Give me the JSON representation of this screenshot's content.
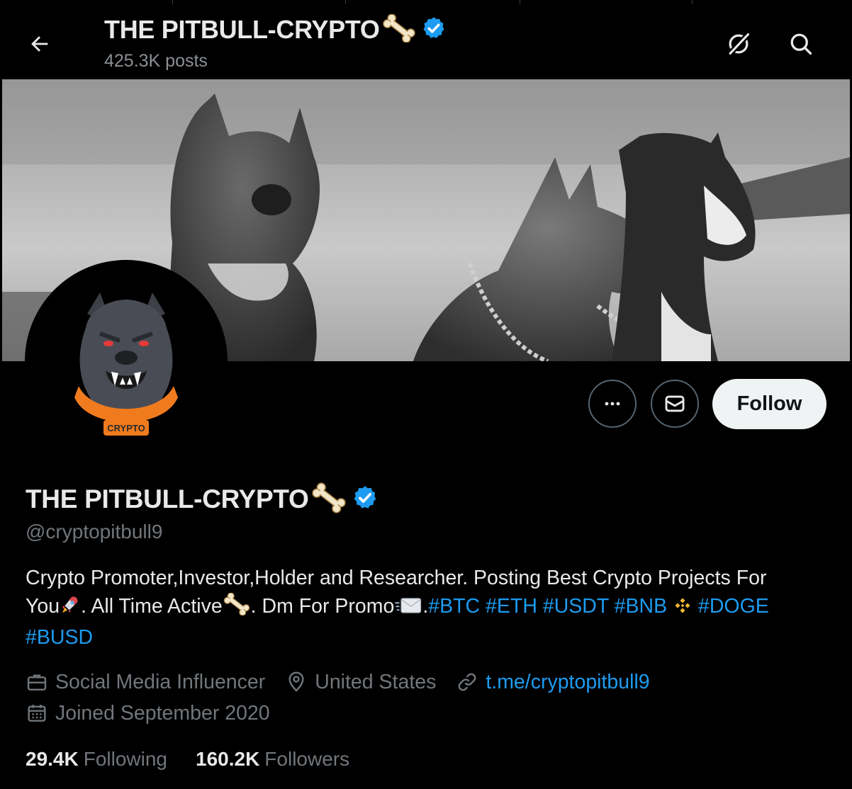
{
  "header": {
    "title": "THE PITBULL-CRYPTO",
    "posts_count": "425.3K posts"
  },
  "profile": {
    "display_name": "THE PITBULL-CRYPTO",
    "handle": "@cryptopitbull9",
    "avatar_badge_text": "CRYPTO",
    "bio": {
      "line1": "Crypto Promoter,Investor,Holder and Researcher. Posting Best Crypto Projects For",
      "you": "You",
      "all_time_active": ". All Time Active",
      "dm_promo": ". Dm For Promo",
      "dot": ".",
      "tags": [
        "#BTC",
        "#ETH",
        "#USDT",
        "#BNB",
        "#DOGE",
        "#BUSD"
      ]
    },
    "category": "Social Media Influencer",
    "location": "United States",
    "link": "t.me/cryptopitbull9",
    "joined": "Joined September 2020",
    "following_count": "29.4K",
    "following_label": "Following",
    "followers_count": "160.2K",
    "followers_label": "Followers"
  },
  "actions": {
    "follow_label": "Follow"
  },
  "icons": {
    "back": "arrow-left-icon",
    "grok": "grok-icon",
    "search": "search-icon",
    "more": "more-icon",
    "message": "message-icon",
    "verified": "verified-badge-icon",
    "bone": "bone-emoji",
    "rocket": "rocket-emoji",
    "envelope": "envelope-emoji",
    "bnb": "bnb-logo-icon",
    "briefcase": "briefcase-icon",
    "location": "location-icon",
    "link": "link-icon",
    "calendar": "calendar-icon"
  },
  "colors": {
    "background": "#000000",
    "text": "#e7e9ea",
    "secondary_text": "#71767b",
    "link": "#1d9bf0",
    "follow_button_bg": "#eff3f4",
    "verified": "#1d9bf0"
  }
}
